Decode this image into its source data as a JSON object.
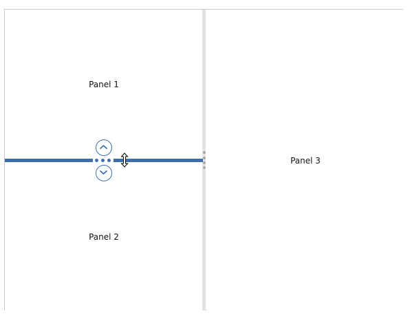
{
  "panels": [
    {
      "label": "Panel 1"
    },
    {
      "label": "Panel 2"
    },
    {
      "label": "Panel 3"
    }
  ],
  "splitter": {
    "accent_color": "#3b6eb0",
    "idle_color": "#e3e3e3",
    "collapse_up_icon": "chevron-up-icon",
    "collapse_down_icon": "chevron-down-icon",
    "cursor_icon": "resize-vertical-cursor-icon"
  }
}
